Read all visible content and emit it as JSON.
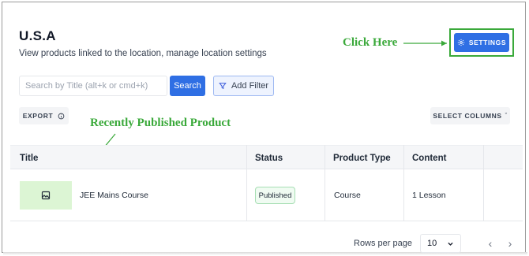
{
  "page": {
    "title": "U.S.A",
    "subtitle": "View products linked to the location, manage location settings"
  },
  "annotations": {
    "click_here": "Click Here",
    "recently_published": "Recently Published Product",
    "color": "#3aa93a"
  },
  "header_actions": {
    "settings_label": "SETTINGS",
    "settings_icon": "gear-icon"
  },
  "toolbar": {
    "search_placeholder": "Search by Title (alt+k or cmd+k)",
    "search_value": "",
    "search_button": "Search",
    "filter_button": "Add Filter",
    "filter_icon": "funnel-icon",
    "export_button": "EXPORT",
    "export_icon": "info-icon",
    "select_columns_button": "SELECT COLUMNS",
    "select_columns_icon": "chevron-down-icon"
  },
  "table": {
    "columns": [
      "Title",
      "Status",
      "Product Type",
      "Content"
    ],
    "rows": [
      {
        "thumbnail_icon": "image-icon",
        "title": "JEE Mains Course",
        "status": "Published",
        "product_type": "Course",
        "content": "1 Lesson"
      }
    ]
  },
  "pagination": {
    "rows_per_page_label": "Rows per page",
    "rows_per_page_value": "10",
    "prev_icon": "chevron-left-icon",
    "next_icon": "chevron-right-icon"
  },
  "colors": {
    "primary": "#2f6fe4",
    "annotation_green": "#3aa93a",
    "thumbnail_bg": "#dcf5d4",
    "published_border": "#a7dfb4"
  }
}
